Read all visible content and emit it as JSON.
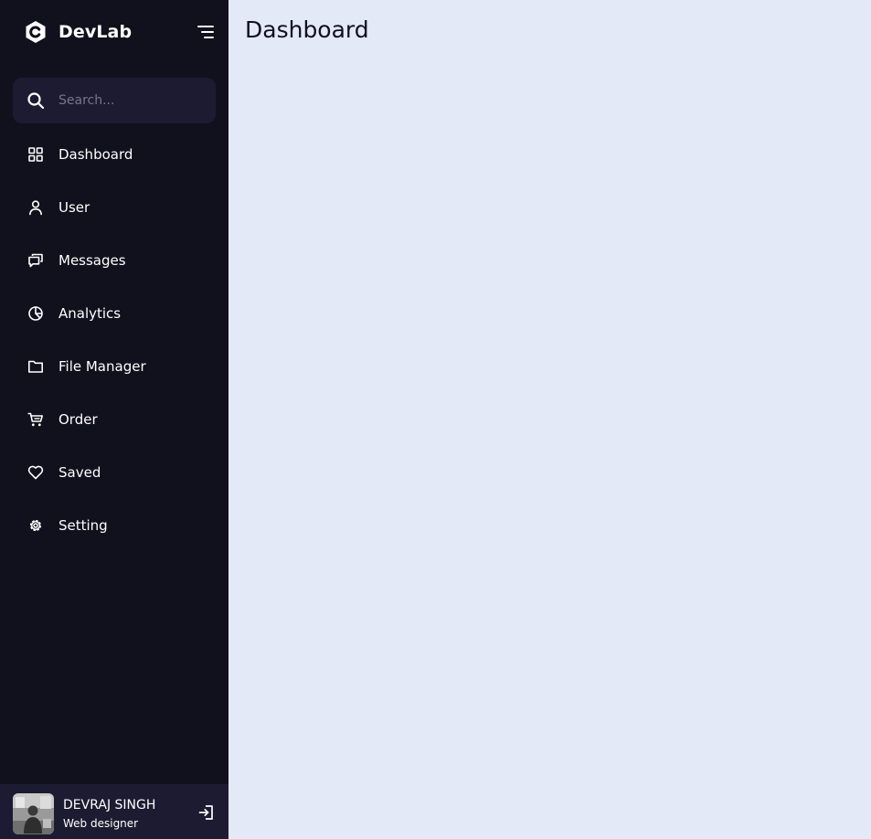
{
  "brand": {
    "name": "DevLab",
    "icon": "hexagon-c-logo-icon"
  },
  "sidebar": {
    "toggle_icon": "menu-lines-icon",
    "search": {
      "placeholder": "Search...",
      "value": "",
      "icon": "search-icon"
    },
    "items": [
      {
        "label": "Dashboard",
        "icon": "grid-icon"
      },
      {
        "label": "User",
        "icon": "user-icon"
      },
      {
        "label": "Messages",
        "icon": "chat-icon"
      },
      {
        "label": "Analytics",
        "icon": "pie-chart-icon"
      },
      {
        "label": "File Manager",
        "icon": "folder-icon"
      },
      {
        "label": "Order",
        "icon": "cart-icon"
      },
      {
        "label": "Saved",
        "icon": "heart-icon"
      },
      {
        "label": "Setting",
        "icon": "gear-icon"
      }
    ],
    "profile": {
      "name": "DEVRAJ SINGH",
      "job": "Web designer",
      "logout_icon": "logout-icon"
    }
  },
  "main": {
    "title": "Dashboard"
  },
  "colors": {
    "sidebar_bg": "#11101d",
    "search_bg": "#1d1b31",
    "main_bg": "#e3e9f7",
    "text_light": "#ffffff",
    "text_dark": "#11101d"
  }
}
